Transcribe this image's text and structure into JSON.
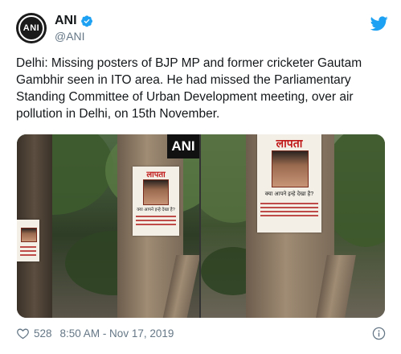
{
  "account": {
    "display_name": "ANI",
    "handle": "@ANI",
    "avatar_text": "ANI",
    "verified": true
  },
  "tweet": {
    "text": "Delhi: Missing posters of BJP MP and former cricketer Gautam Gambhir seen in ITO area. He had missed the Parliamentary Standing Committee of Urban Development meeting, over air pollution in Delhi, on 15th November."
  },
  "media": {
    "watermark": "ANI",
    "left_poster_title": "लापता",
    "left_poster_subtitle": "क्या आपने इन्हे देखा है?",
    "right_poster_title": "लापता",
    "right_poster_subtitle": "क्या आपने इन्हे देखा है?"
  },
  "footer": {
    "likes": "528",
    "timestamp": "8:50 AM - Nov 17, 2019"
  },
  "colors": {
    "twitter_blue": "#1da1f2",
    "secondary_text": "#657786",
    "primary_text": "#14171a"
  }
}
